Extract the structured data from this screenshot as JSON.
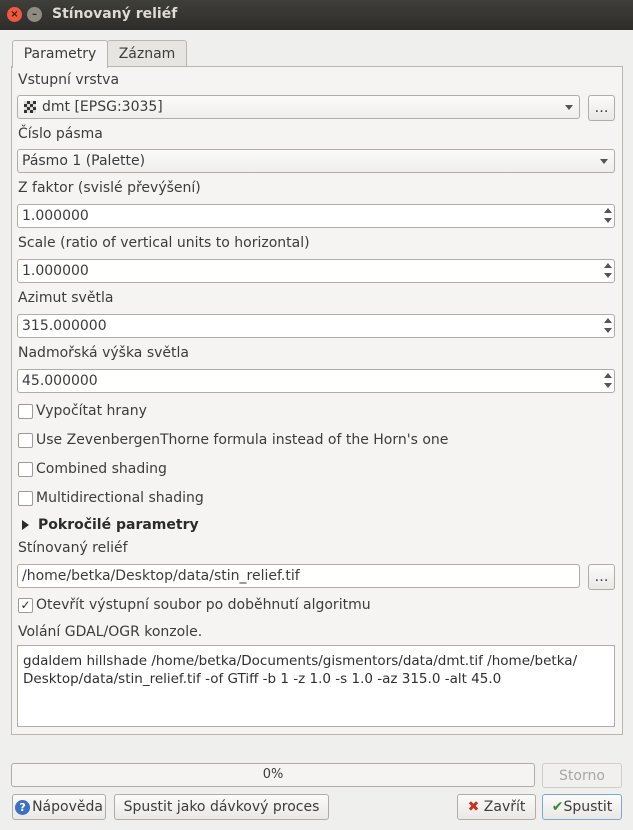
{
  "window": {
    "title": "Stínovaný reliéf"
  },
  "tabs": [
    {
      "label": "Parametry",
      "active": true
    },
    {
      "label": "Záznam",
      "active": false
    }
  ],
  "params": {
    "input_layer_label": "Vstupní vrstva",
    "input_layer_value": "dmt [EPSG:3035]",
    "band_label": "Číslo pásma",
    "band_value": "Pásmo 1 (Palette)",
    "zfactor_label": "Z faktor (svislé převýšení)",
    "zfactor_value": "1.000000",
    "scale_label": "Scale (ratio of vertical units to horizontal)",
    "scale_value": "1.000000",
    "azimuth_label": "Azimut světla",
    "azimuth_value": "315.000000",
    "altitude_label": "Nadmořská výška světla",
    "altitude_value": "45.000000",
    "browse_label": "…"
  },
  "checkboxes": [
    {
      "label": "Vypočítat hrany",
      "checked": false
    },
    {
      "label": "Use ZevenbergenThorne formula instead of the Horn's one",
      "checked": false
    },
    {
      "label": "Combined shading",
      "checked": false
    },
    {
      "label": "Multidirectional shading",
      "checked": false
    }
  ],
  "advanced": {
    "label": "Pokročilé parametry"
  },
  "output": {
    "label": "Stínovaný reliéf",
    "value": "/home/betka/Desktop/data/stin_relief.tif",
    "open_after_label": "Otevřít výstupní soubor po doběhnutí algoritmu",
    "open_after_checked": true,
    "check_mark": "✓"
  },
  "console": {
    "label": "Volání GDAL/OGR konzole.",
    "line1": "gdaldem hillshade /home/betka/Documents/gismentors/data/dmt.tif /home/betka/",
    "line2": "Desktop/data/stin_relief.tif -of GTiff -b 1 -z 1.0 -s 1.0 -az 315.0 -alt 45.0"
  },
  "footer": {
    "progress_text": "0%",
    "progress_value": 0,
    "cancel_label": "Storno",
    "help_label": "Nápověda",
    "batch_label": "Spustit jako dávkový proces",
    "close_label": "Zavřít",
    "run_label": "Spustit"
  },
  "colors": {
    "run_accent": "#3a8a2e",
    "close_accent": "#c7341f",
    "help_accent": "#3d6fc4"
  }
}
